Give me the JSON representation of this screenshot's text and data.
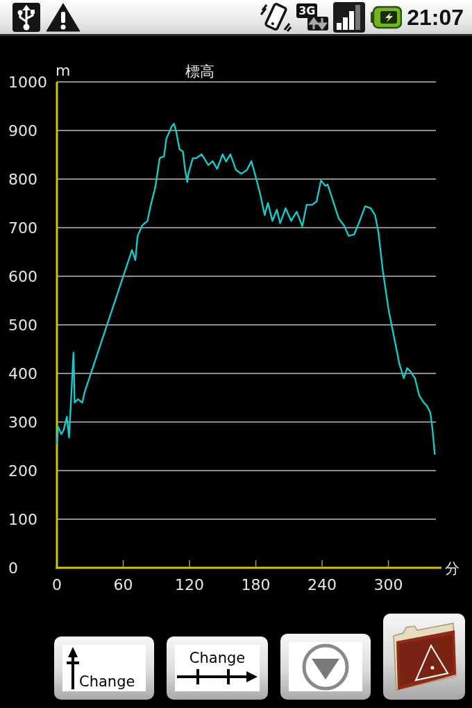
{
  "status_bar": {
    "network_type": "3G",
    "time": "21:07"
  },
  "chart": {
    "chart_data": {
      "type": "line",
      "title": "標高",
      "xlabel": "分",
      "ylabel": "m",
      "grid": true,
      "x": [
        0,
        1,
        4,
        6,
        9,
        11,
        15,
        16,
        19,
        23,
        25,
        68,
        71,
        73,
        77,
        82,
        85,
        89,
        93,
        97,
        99,
        104,
        106,
        108,
        111,
        114,
        116,
        118,
        119,
        123,
        126,
        131,
        137,
        141,
        145,
        150,
        153,
        157,
        162,
        167,
        172,
        176,
        180,
        184,
        188,
        191,
        195,
        199,
        202,
        207,
        212,
        217,
        222,
        226,
        231,
        235,
        239,
        243,
        245,
        250,
        255,
        260,
        264,
        269,
        274,
        279,
        284,
        288,
        291,
        295,
        300,
        305,
        310,
        314,
        317,
        320,
        324,
        328,
        332,
        335,
        338,
        340,
        342
      ],
      "series": [
        {
          "color": "#19c8c8",
          "values": [
            254,
            290,
            275,
            283,
            311,
            268,
            443,
            340,
            347,
            340,
            361,
            654,
            633,
            683,
            704,
            714,
            747,
            783,
            843,
            847,
            883,
            909,
            914,
            897,
            861,
            857,
            819,
            794,
            811,
            843,
            843,
            851,
            829,
            837,
            821,
            851,
            836,
            851,
            819,
            811,
            819,
            837,
            804,
            769,
            726,
            751,
            714,
            737,
            709,
            740,
            714,
            733,
            703,
            747,
            747,
            754,
            797,
            786,
            789,
            754,
            719,
            704,
            683,
            686,
            714,
            744,
            740,
            726,
            690,
            611,
            533,
            476,
            419,
            390,
            411,
            404,
            390,
            354,
            340,
            333,
            319,
            283,
            233
          ]
        }
      ],
      "xlim": [
        0,
        343
      ],
      "ylim": [
        0,
        1000
      ],
      "xticks": [
        0,
        60,
        120,
        180,
        240,
        300
      ],
      "yticks": [
        0,
        100,
        200,
        300,
        400,
        500,
        600,
        700,
        800,
        900,
        1000
      ]
    }
  },
  "buttons": [
    {
      "kind": "y-axis",
      "label": "Change"
    },
    {
      "kind": "x-axis",
      "label": "Change"
    },
    {
      "kind": "down"
    },
    {
      "kind": "folder"
    }
  ]
}
